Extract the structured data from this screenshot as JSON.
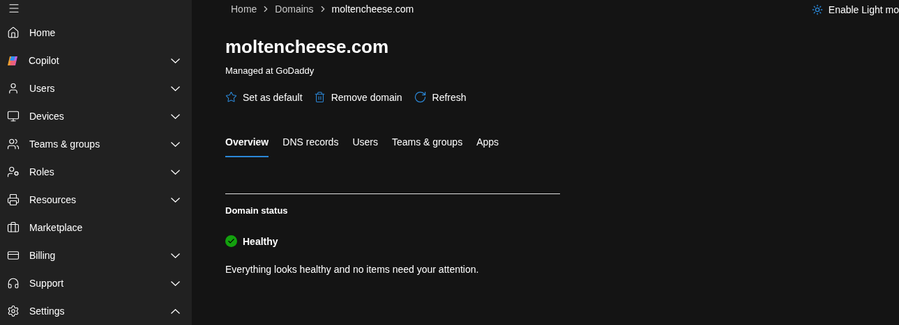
{
  "sidebar": {
    "items": [
      {
        "label": "Home",
        "kind": "link"
      },
      {
        "label": "Copilot",
        "kind": "group",
        "expanded": false
      },
      {
        "label": "Users",
        "kind": "group",
        "expanded": false
      },
      {
        "label": "Devices",
        "kind": "group",
        "expanded": false
      },
      {
        "label": "Teams & groups",
        "kind": "group",
        "expanded": false
      },
      {
        "label": "Roles",
        "kind": "group",
        "expanded": false
      },
      {
        "label": "Resources",
        "kind": "group",
        "expanded": false
      },
      {
        "label": "Marketplace",
        "kind": "link"
      },
      {
        "label": "Billing",
        "kind": "group",
        "expanded": false
      },
      {
        "label": "Support",
        "kind": "group",
        "expanded": false
      },
      {
        "label": "Settings",
        "kind": "group",
        "expanded": true
      }
    ]
  },
  "breadcrumb": [
    {
      "label": "Home",
      "current": false
    },
    {
      "label": "Domains",
      "current": false
    },
    {
      "label": "moltencheese.com",
      "current": true
    }
  ],
  "theme_toggle": {
    "label": "Enable Light mo"
  },
  "title": "moltencheese.com",
  "subtitle": "Managed at GoDaddy",
  "actions": [
    {
      "label": "Set as default",
      "kind": "star"
    },
    {
      "label": "Remove domain",
      "kind": "delete"
    },
    {
      "label": "Refresh",
      "kind": "refresh"
    }
  ],
  "tabs": [
    {
      "label": "Overview",
      "selected": true
    },
    {
      "label": "DNS records",
      "selected": false
    },
    {
      "label": "Users",
      "selected": false
    },
    {
      "label": "Teams & groups",
      "selected": false
    },
    {
      "label": "Apps",
      "selected": false
    }
  ],
  "status": {
    "heading": "Domain status",
    "healthy": true,
    "label": "Healthy",
    "message": "Everything looks healthy and no items need your attention."
  }
}
